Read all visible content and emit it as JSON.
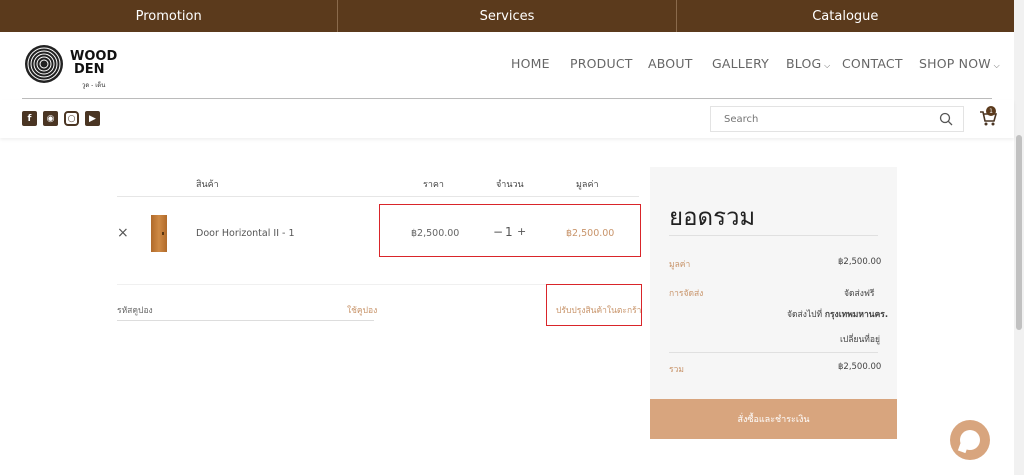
{
  "topbar": {
    "items": [
      "Promotion",
      "Services",
      "Catalogue"
    ]
  },
  "logo": {
    "line1": "WOOD",
    "line2": "DEN",
    "sub": "วูด - เด็น"
  },
  "nav": {
    "home": "HOME",
    "product": "PRODUCT",
    "about": "ABOUT",
    "gallery": "GALLERY",
    "blog": "BLOG",
    "contact": "CONTACT",
    "shop": "SHOP NOW"
  },
  "search": {
    "placeholder": "Search"
  },
  "cart": {
    "count": "1"
  },
  "table": {
    "headers": {
      "product": "สินค้า",
      "price": "ราคา",
      "qty": "จำนวน",
      "total": "มูลค่า"
    },
    "row": {
      "remove": "×",
      "name": "Door Horizontal II - 1",
      "price": "฿2,500.00",
      "qty": "1",
      "minus": "−",
      "plus": "+",
      "subtotal": "฿2,500.00"
    }
  },
  "coupon": {
    "placeholder": "รหัสคูปอง",
    "apply": "ใช้คูปอง",
    "update": "ปรับปรุงสินค้าในตะกร้า"
  },
  "summary": {
    "title": "ยอดรวม",
    "subtotal_label": "มูลค่า",
    "subtotal": "฿2,500.00",
    "shipping_label": "การจัดส่ง",
    "shipping": "จัดส่งฟรี",
    "ship_to": "จัดส่งไปที่",
    "ship_city": "กรุงเทพมหานคร.",
    "change_address": "เปลี่ยนที่อยู่",
    "total_label": "รวม",
    "total": "฿2,500.00",
    "checkout": "สั่งซื้อและชำระเงิน"
  },
  "colors": {
    "brown": "#5b3a1c",
    "accent": "#c8946a",
    "button": "#d8a57e",
    "highlight": "#d9252a"
  }
}
